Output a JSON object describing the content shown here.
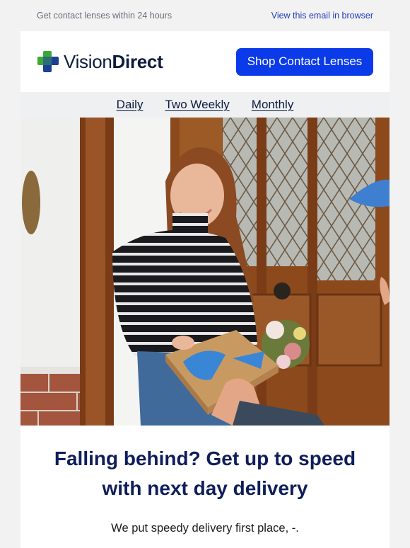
{
  "preheader": {
    "tagline": "Get contact lenses within 24 hours",
    "view_in_browser": "View this email in browser"
  },
  "header": {
    "brand": {
      "part1": "Vision",
      "part2": "Direct"
    },
    "logo_icon": "medical-cross-icon",
    "cta_label": "Shop Contact Lenses",
    "cta_color": "#0b3be8"
  },
  "nav": {
    "items": [
      {
        "label": "Daily"
      },
      {
        "label": "Two Weekly"
      },
      {
        "label": "Monthly"
      }
    ]
  },
  "hero": {
    "image": "woman-receiving-delivery-box-photo"
  },
  "content": {
    "headline_line1": "Falling behind? Get up to speed",
    "headline_line2": "with next day delivery",
    "body": "We put speedy delivery first place, -."
  }
}
